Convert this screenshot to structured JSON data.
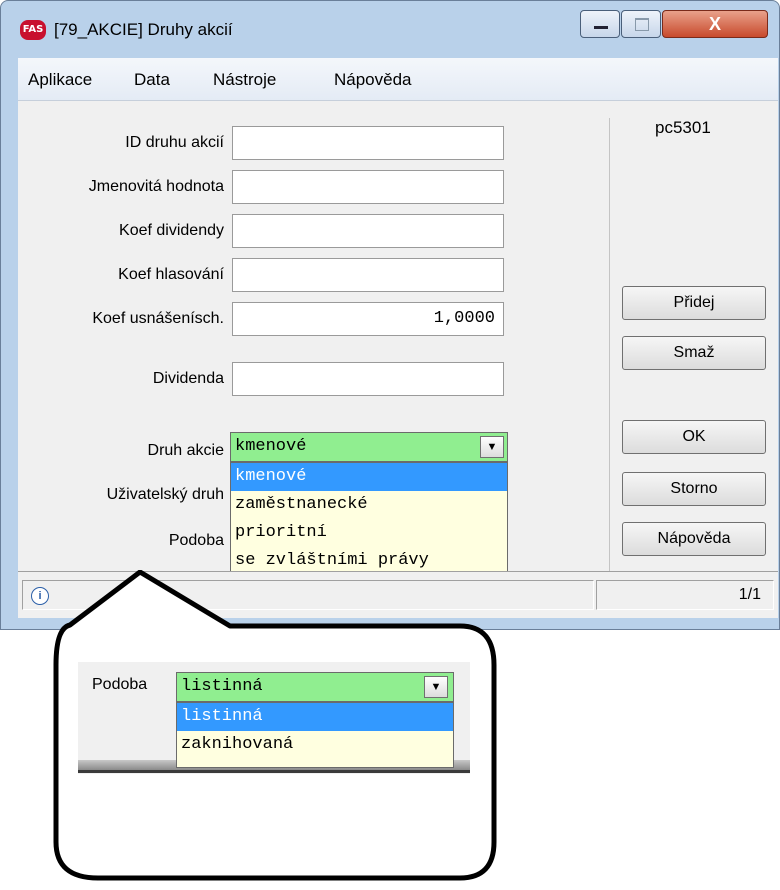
{
  "window": {
    "app_badge": "FAS",
    "title": "[79_AKCIE] Druhy akcií",
    "close_glyph": "X"
  },
  "menu": [
    "Aplikace",
    "Data",
    "Nástroje",
    "Nápověda"
  ],
  "pc": "pc5301",
  "form": {
    "id_label": "ID druhu akcií",
    "id_value": "",
    "nominal_label": "Jmenovitá hodnota",
    "nominal_value": "",
    "div_coef_label": "Koef dividendy",
    "div_coef_value": "",
    "vote_coef_label": "Koef hlasování",
    "vote_coef_value": "",
    "res_coef_label": "Koef usnášenísch.",
    "res_coef_value": "1,0000",
    "dividend_label": "Dividenda",
    "dividend_value": "",
    "type_label": "Druh akcie",
    "type_value": "kmenové",
    "type_options": [
      "kmenové",
      "zaměstnanecké",
      "prioritní",
      "se zvláštními právy"
    ],
    "user_type_label": "Uživatelský druh",
    "form_label": "Podoba"
  },
  "buttons": {
    "add": "Přidej",
    "delete": "Smaž",
    "ok": "OK",
    "cancel": "Storno",
    "help": "Nápověda"
  },
  "status": {
    "record": "1/1"
  },
  "callout": {
    "label": "Podoba",
    "value": "listinná",
    "options": [
      "listinná",
      "zaknihovaná"
    ]
  }
}
